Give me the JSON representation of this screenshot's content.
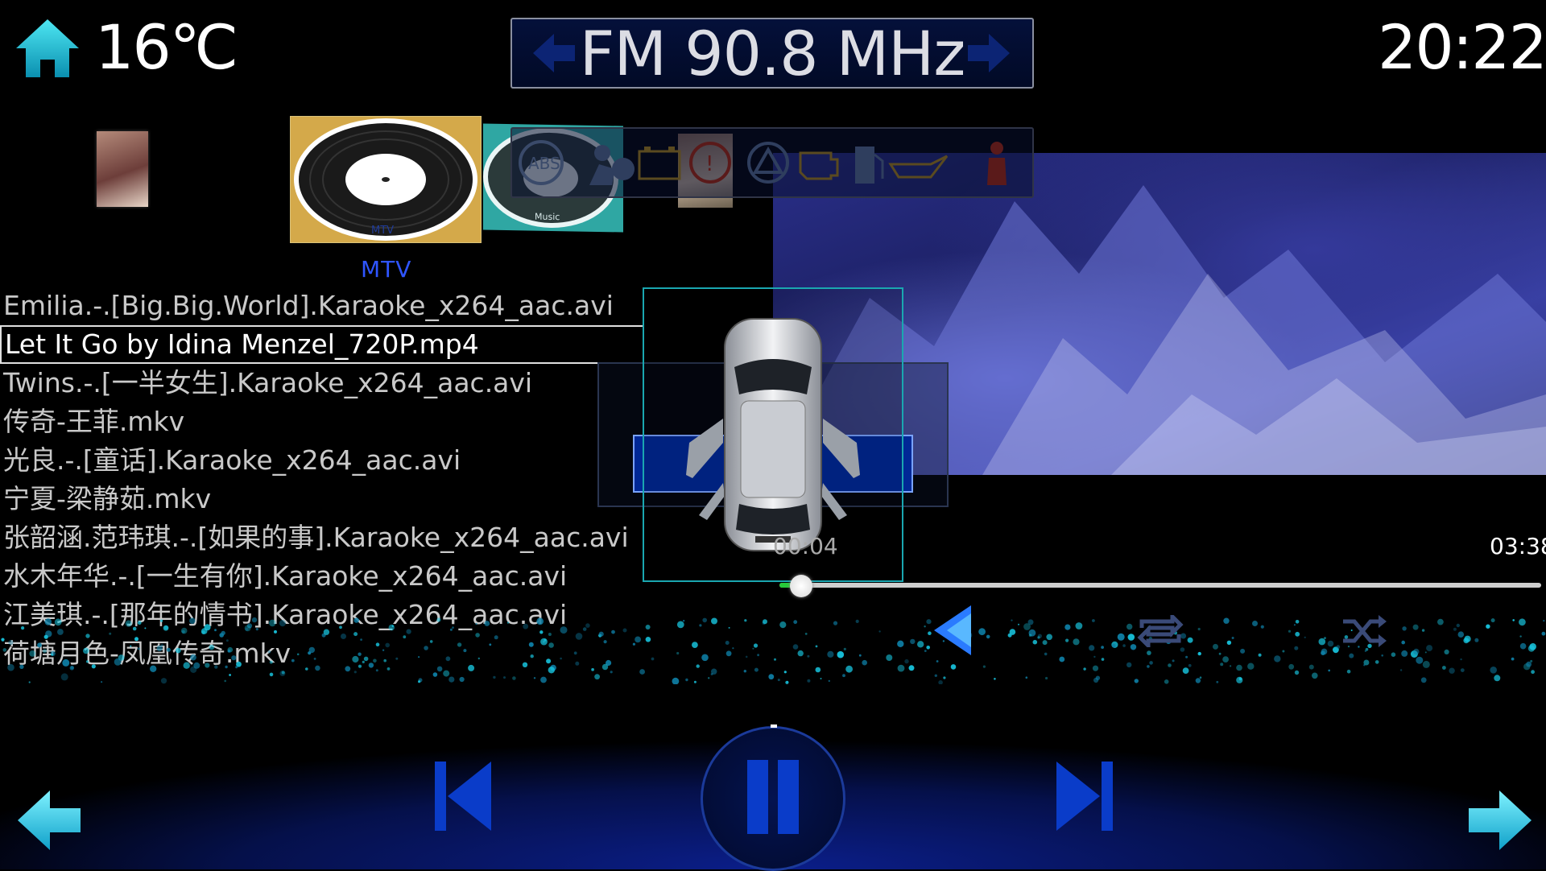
{
  "header": {
    "temperature": "16℃",
    "radio_label": "FM 90.8 MHz",
    "clock": "20:22"
  },
  "carousel": {
    "selected_source_label": "MTV",
    "disc_label_mtv": "MTV",
    "disc_label_music": "Music"
  },
  "playlist": {
    "items": [
      "Emilia.-.[Big.Big.World].Karaoke_x264_aac.avi",
      "Let It Go by Idina Menzel_720P.mp4",
      "Twins.-.[一半女生].Karaoke_x264_aac.avi",
      "传奇-王菲.mkv",
      "光良.-.[童话].Karaoke_x264_aac.avi",
      "宁夏-梁静茹.mkv",
      "张韶涵.范玮琪.-.[如果的事].Karaoke_x264_aac.avi",
      "水木年华.-.[一生有你].Karaoke_x264_aac.avi",
      "江美琪.-.[那年的情书].Karaoke_x264_aac.avi",
      "荷塘月色-凤凰传奇.mkv"
    ],
    "selected_index": 1
  },
  "player": {
    "time_elapsed": "00:04",
    "time_total": "03:38",
    "progress_fraction": 0.029,
    "state": "playing"
  },
  "colors": {
    "accent_cyan": "#18c6e0",
    "accent_blue": "#0a3cc9",
    "progress_green": "#27c93a",
    "source_label_blue": "#2f55ff"
  },
  "icons": {
    "home": "home-icon",
    "radio_prev": "arrow-left-icon",
    "radio_next": "arrow-right-icon",
    "warnings": [
      "abs-warning-icon",
      "airbag-warning-icon",
      "battery-warning-icon",
      "brake-warning-icon",
      "hazard-warning-icon",
      "engine-warning-icon",
      "fuel-warning-icon",
      "oil-warning-icon",
      "seatbelt-warning-icon"
    ],
    "back": "back-triangle-icon",
    "repeat": "repeat-icon",
    "shuffle": "shuffle-icon",
    "prev_track": "skip-previous-icon",
    "pause": "pause-icon",
    "next_track": "skip-next-icon",
    "page_prev": "page-prev-arrow-icon",
    "page_next": "page-next-arrow-icon"
  }
}
